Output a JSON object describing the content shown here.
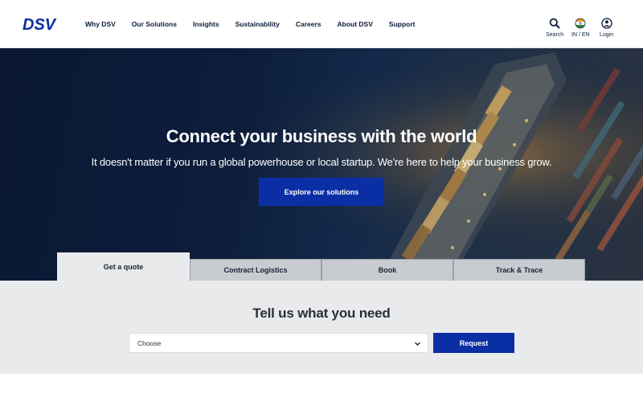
{
  "brand": {
    "logo_text": "DSV",
    "color": "#0a2fa5"
  },
  "nav": {
    "items": [
      "Why DSV",
      "Our Solutions",
      "Insights",
      "Sustainability",
      "Careers",
      "About DSV",
      "Support"
    ]
  },
  "utilities": {
    "search": {
      "label": "Search",
      "icon": "search-icon"
    },
    "language": {
      "label": "IN / EN",
      "icon": "india-flag-icon"
    },
    "login": {
      "label": "Login",
      "icon": "user-icon"
    }
  },
  "hero": {
    "title": "Connect your business with the world",
    "subtitle": "It doesn't matter if you run a global powerhouse or local startup. We're here to help your business grow.",
    "cta_label": "Explore our solutions"
  },
  "tabs": [
    {
      "label": "Get a quote",
      "active": true
    },
    {
      "label": "Contract Logistics",
      "active": false
    },
    {
      "label": "Book",
      "active": false
    },
    {
      "label": "Track & Trace",
      "active": false
    }
  ],
  "quote": {
    "title": "Tell us what you need",
    "select_value": "Choose",
    "request_label": "Request"
  },
  "colors": {
    "accent": "#0a2fa5",
    "panel": "#e9eaec",
    "hero_dark": "#0a1833"
  }
}
